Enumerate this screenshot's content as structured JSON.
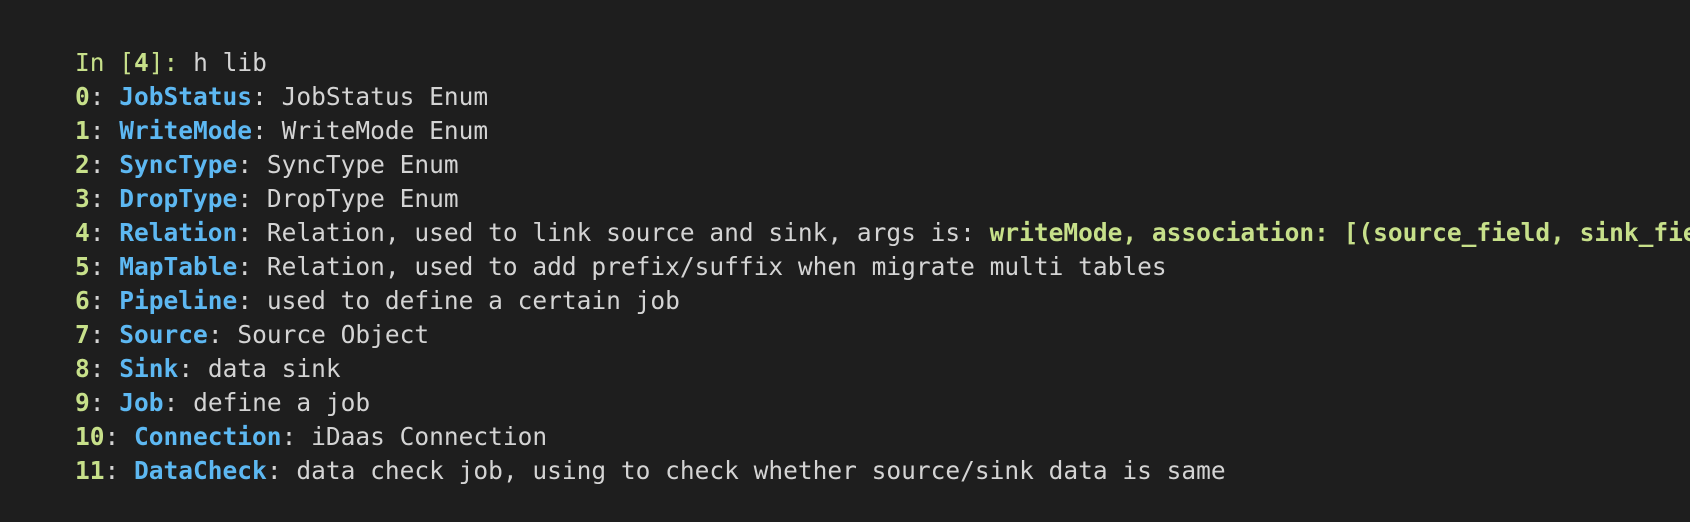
{
  "prompt": {
    "prefix": "In [",
    "number": "4",
    "suffix": "]: ",
    "command": "h lib"
  },
  "entries": [
    {
      "index": "0",
      "name": "JobStatus",
      "desc": "JobStatus Enum",
      "highlight": ""
    },
    {
      "index": "1",
      "name": "WriteMode",
      "desc": "WriteMode Enum",
      "highlight": ""
    },
    {
      "index": "2",
      "name": "SyncType",
      "desc": "SyncType Enum",
      "highlight": ""
    },
    {
      "index": "3",
      "name": "DropType",
      "desc": "DropType Enum",
      "highlight": ""
    },
    {
      "index": "4",
      "name": "Relation",
      "desc": "Relation, used to link source and sink, args is: ",
      "highlight": "writeMode, association: [(source_field, sink_field)]"
    },
    {
      "index": "5",
      "name": "MapTable",
      "desc": "Relation, used to add prefix/suffix when migrate multi tables",
      "highlight": ""
    },
    {
      "index": "6",
      "name": "Pipeline",
      "desc": "used to define a certain job",
      "highlight": ""
    },
    {
      "index": "7",
      "name": "Source",
      "desc": "Source Object",
      "highlight": ""
    },
    {
      "index": "8",
      "name": "Sink",
      "desc": "data sink",
      "highlight": ""
    },
    {
      "index": "9",
      "name": "Job",
      "desc": "define a job",
      "highlight": ""
    },
    {
      "index": "10",
      "name": "Connection",
      "desc": "iDaas Connection",
      "highlight": ""
    },
    {
      "index": "11",
      "name": "DataCheck",
      "desc": "data check job, using to check whether source/sink data is same",
      "highlight": ""
    }
  ],
  "separator": ": ",
  "colors": {
    "background": "#1e1e1e",
    "text": "#d4d4d4",
    "accent_green": "#c7e08a",
    "accent_blue": "#5db8f2"
  }
}
